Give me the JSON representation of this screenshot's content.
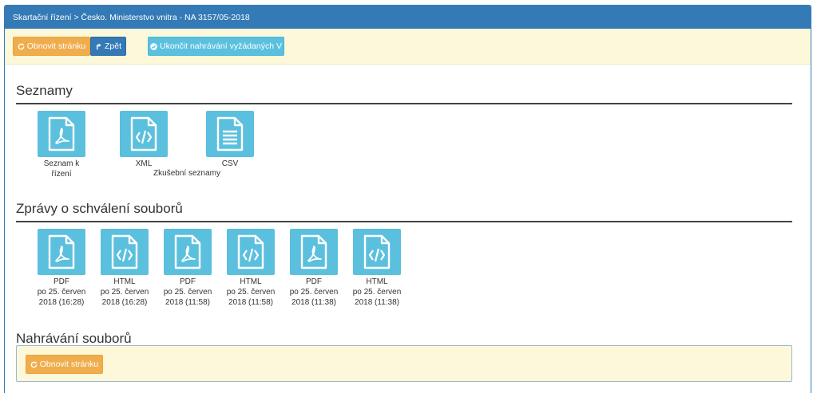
{
  "header": {
    "breadcrumb": "Skartační řízení > Česko. Ministerstvo vnitra - NA 3157/05-2018"
  },
  "toolbar": {
    "refresh_label": "Obnovit stránku",
    "back_label": "Zpět",
    "end_upload_label": "Ukončit nahrávání vyžádaných V"
  },
  "lists": {
    "title": "Seznamy",
    "items": [
      {
        "type": "pdf",
        "label1": "Seznam k",
        "label2": "řízení"
      },
      {
        "type": "xml",
        "label1": "XML",
        "label2": ""
      },
      {
        "type": "csv",
        "label1": "CSV",
        "label2": ""
      }
    ],
    "group_label": "Zkušební seznamy"
  },
  "reports": {
    "title": "Zprávy o schválení souborů",
    "items": [
      {
        "type": "pdf",
        "label1": "PDF",
        "label2": "po 25. červen",
        "label3": "2018 (16:28)"
      },
      {
        "type": "xml",
        "label1": "HTML",
        "label2": "po 25. červen",
        "label3": "2018 (16:28)"
      },
      {
        "type": "pdf",
        "label1": "PDF",
        "label2": "po 25. červen",
        "label3": "2018 (11:58)"
      },
      {
        "type": "xml",
        "label1": "HTML",
        "label2": "po 25. červen",
        "label3": "2018 (11:58)"
      },
      {
        "type": "pdf",
        "label1": "PDF",
        "label2": "po 25. červen",
        "label3": "2018 (11:38)"
      },
      {
        "type": "xml",
        "label1": "HTML",
        "label2": "po 25. červen",
        "label3": "2018 (11:38)"
      }
    ]
  },
  "upload": {
    "title": "Nahrávání souborů",
    "refresh_label": "Obnovit stránku"
  },
  "colors": {
    "primary": "#337ab7",
    "warning": "#f0ad4e",
    "info": "#5bc0de",
    "panel_bg": "#fcf8d9"
  }
}
